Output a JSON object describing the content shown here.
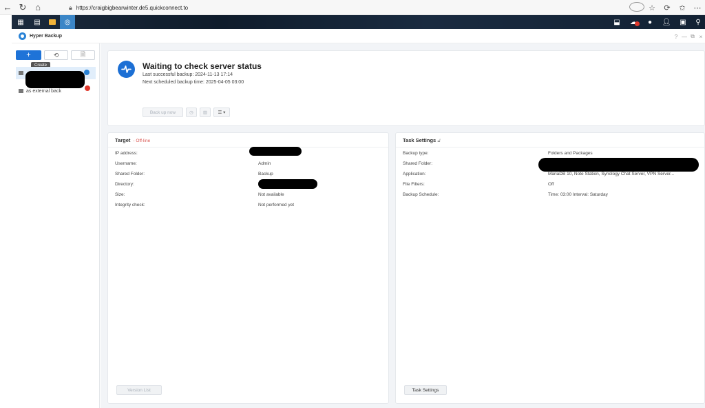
{
  "browser": {
    "url": "https://craigbigbearwinter.de5.quickconnect.to"
  },
  "window": {
    "title": "Hyper Backup",
    "help": "?",
    "minimize": "—",
    "restore": "⧉",
    "close": "×"
  },
  "toolbar": {
    "create_tooltip": "Create"
  },
  "tasks": [
    {
      "label": "",
      "status": "ok"
    },
    {
      "label": "as external back",
      "status": "error"
    }
  ],
  "status": {
    "title": "Waiting to check server status",
    "last_backup": "Last successful backup: 2024-11-13 17:14",
    "next_backup": "Next scheduled backup time: 2025-04-05 03:00",
    "back_up_now": "Back up now"
  },
  "target": {
    "title": "Target",
    "status": "- Off-line",
    "rows": [
      {
        "key": "IP address:",
        "value": ""
      },
      {
        "key": "Username:",
        "value": "Admin"
      },
      {
        "key": "Shared Folder:",
        "value": "Backup"
      },
      {
        "key": "Directory:",
        "value": ""
      },
      {
        "key": "Size:",
        "value": "Not available"
      },
      {
        "key": "Integrity check:",
        "value": "Not performed yet"
      }
    ],
    "version_list": "Version List"
  },
  "settings": {
    "title": "Task Settings",
    "rows": [
      {
        "key": "Backup type:",
        "value": "Folders and Packages"
      },
      {
        "key": "Shared Folder:",
        "value": ""
      },
      {
        "key": "Application:",
        "value": "MariaDB 10, Note Station, Synology Chat Server, VPN Server..."
      },
      {
        "key": "File Filters:",
        "value": "Off"
      },
      {
        "key": "Backup Schedule:",
        "value": "Time: 03:00 Interval: Saturday"
      }
    ],
    "task_settings_button": "Task Settings"
  },
  "colors": {
    "accent": "#1e73d8",
    "offline": "#d9534f",
    "error": "#e0392d"
  }
}
